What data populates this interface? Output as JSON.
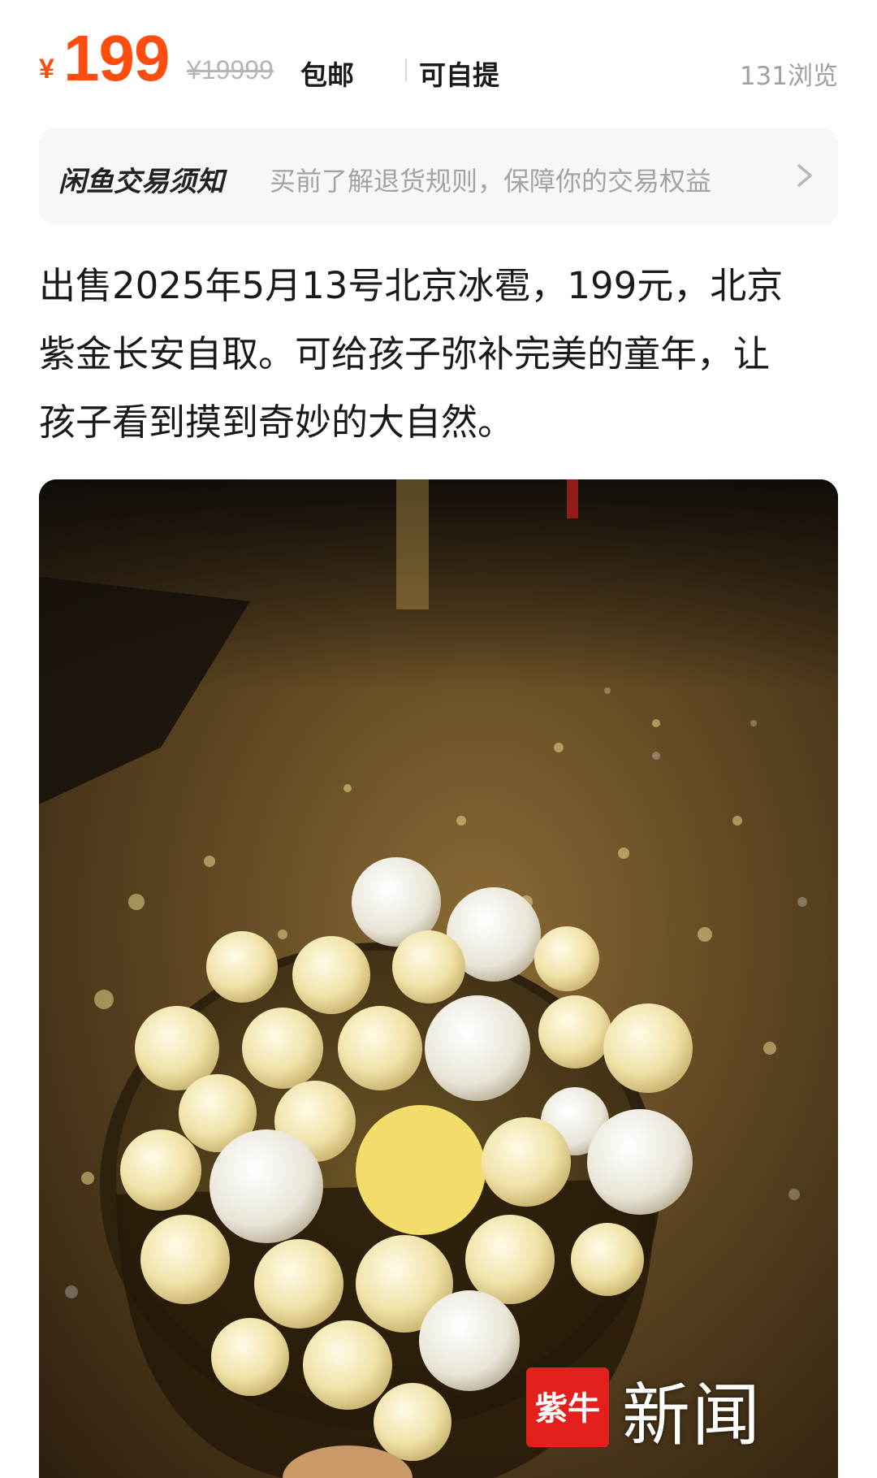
{
  "price": {
    "currency_symbol": "¥",
    "value": "199",
    "original_price": "¥19999",
    "tags": [
      "包邮",
      "可自提"
    ],
    "views": "131浏览"
  },
  "notice": {
    "title": "闲鱼交易须知",
    "text": "买前了解退货规则，保障你的交易权益",
    "icon": "chevron-right-icon"
  },
  "description": {
    "lines": [
      "出售2025年5月13号北京冰雹，199元，北京",
      "紫金长安自取。可给孩子弥补完美的童年，让",
      "孩子看到摸到奇妙的大自然。"
    ]
  },
  "photo": {
    "subject": "hailstones-in-metal-bowl",
    "watermark_text": "新闻",
    "watermark_logo": "紫牛",
    "colors": {
      "price": "#ff4d0f",
      "watermark_red": "#e3201b"
    }
  }
}
